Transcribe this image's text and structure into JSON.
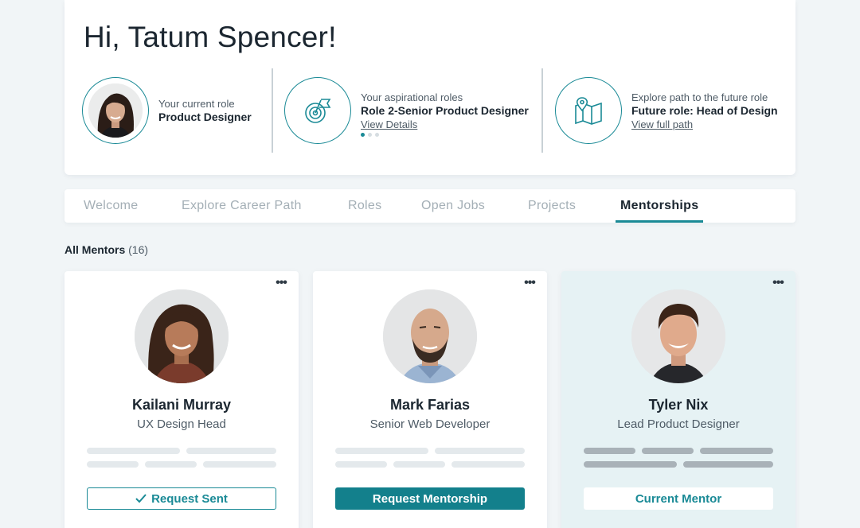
{
  "header": {
    "greeting": "Hi, Tatum Spencer!",
    "current_role": {
      "caption": "Your current role",
      "title": "Product Designer"
    },
    "aspirational": {
      "caption": "Your aspirational roles",
      "title": "Role 2-Senior Product Designer",
      "link": "View Details",
      "carousel_pages": 3,
      "carousel_active": 1
    },
    "future": {
      "caption": "Explore path to the future role",
      "title": "Future role: Head of Design",
      "link": "View full path"
    }
  },
  "tabs": [
    {
      "label": "Welcome",
      "active": false
    },
    {
      "label": "Explore Career Path",
      "active": false
    },
    {
      "label": "Roles",
      "active": false
    },
    {
      "label": "Open Jobs",
      "active": false
    },
    {
      "label": "Projects",
      "active": false
    },
    {
      "label": "Mentorships",
      "active": true
    }
  ],
  "mentors_section": {
    "label": "All Mentors",
    "count": "(16)"
  },
  "mentors": [
    {
      "name": "Kailani Murray",
      "title": "UX Design Head",
      "action": "Request Sent",
      "action_style": "outline",
      "action_icon": "check-icon"
    },
    {
      "name": "Mark Farias",
      "title": "Senior Web Developer",
      "action": "Request Mentorship",
      "action_style": "solid"
    },
    {
      "name": "Tyler Nix",
      "title": "Lead Product Designer",
      "action": "Current Mentor",
      "action_style": "light",
      "highlighted": true
    }
  ],
  "colors": {
    "accent": "#1a8a96",
    "button_fill": "#13808c",
    "page_bg": "#f1f5f7",
    "highlight_card": "#e6f2f4"
  }
}
